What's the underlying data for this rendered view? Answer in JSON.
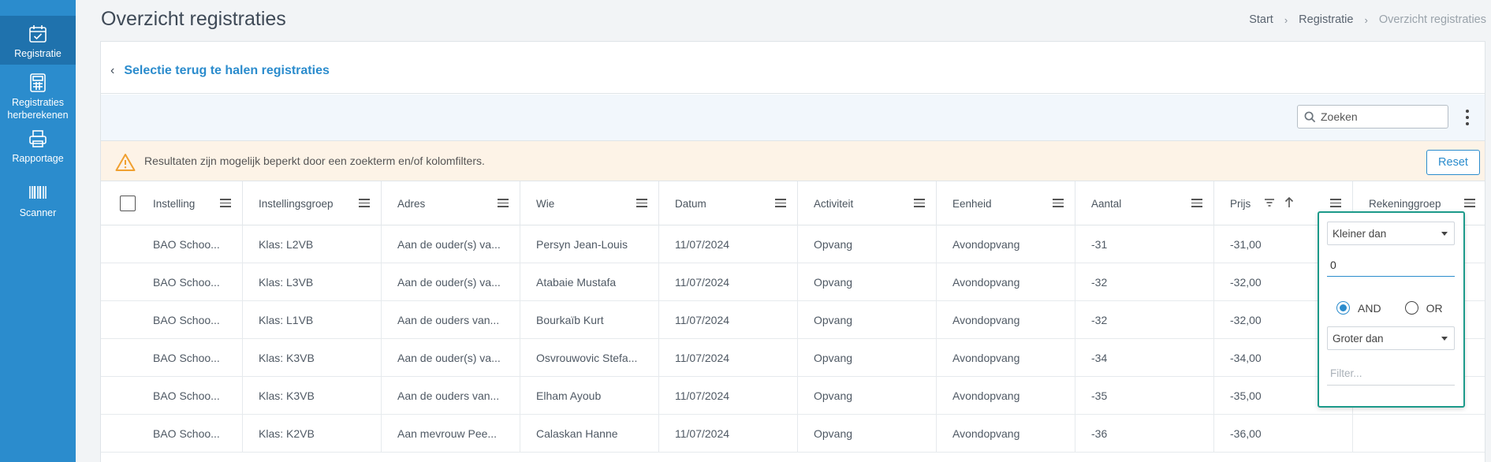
{
  "sidebar": {
    "items": [
      {
        "label": "Registratie",
        "icon": "calendar-check-icon"
      },
      {
        "label": "Registraties herberekenen",
        "icon": "calculator-icon"
      },
      {
        "label": "Rapportage",
        "icon": "printer-icon"
      },
      {
        "label": "Scanner",
        "icon": "barcode-icon"
      }
    ]
  },
  "header": {
    "title": "Overzicht registraties",
    "breadcrumb": [
      "Start",
      "Registratie",
      "Overzicht registraties"
    ]
  },
  "card": {
    "back_label": "Selectie terug te halen registraties",
    "search_placeholder": "Zoeken",
    "warning": "Resultaten zijn mogelijk beperkt door een zoekterm en/of kolomfilters.",
    "reset_label": "Reset"
  },
  "table": {
    "columns": [
      "Instelling",
      "Instellingsgroep",
      "Adres",
      "Wie",
      "Datum",
      "Activiteit",
      "Eenheid",
      "Aantal",
      "Prijs",
      "Rekeninggroep"
    ],
    "rows": [
      [
        "BAO Schoo...",
        "Klas: L2VB",
        "Aan de ouder(s) va...",
        "Persyn Jean-Louis",
        "11/07/2024",
        "Opvang",
        "Avondopvang",
        "-31",
        "-31,00",
        ""
      ],
      [
        "BAO Schoo...",
        "Klas: L3VB",
        "Aan de ouder(s) va...",
        "Atabaie Mustafa",
        "11/07/2024",
        "Opvang",
        "Avondopvang",
        "-32",
        "-32,00",
        ""
      ],
      [
        "BAO Schoo...",
        "Klas: L1VB",
        "Aan de ouders van...",
        "Bourkaïb Kurt",
        "11/07/2024",
        "Opvang",
        "Avondopvang",
        "-32",
        "-32,00",
        ""
      ],
      [
        "BAO Schoo...",
        "Klas: K3VB",
        "Aan de ouder(s) va...",
        "Osvrouwovic Stefa...",
        "11/07/2024",
        "Opvang",
        "Avondopvang",
        "-34",
        "-34,00",
        ""
      ],
      [
        "BAO Schoo...",
        "Klas: K3VB",
        "Aan de ouders van...",
        "Elham Ayoub",
        "11/07/2024",
        "Opvang",
        "Avondopvang",
        "-35",
        "-35,00",
        ""
      ],
      [
        "BAO Schoo...",
        "Klas: K2VB",
        "Aan mevrouw Pee...",
        "Calaskan Hanne",
        "11/07/2024",
        "Opvang",
        "Avondopvang",
        "-36",
        "-36,00",
        ""
      ]
    ]
  },
  "filter_popup": {
    "condition1": "Kleiner dan",
    "value1": "0",
    "operator_and": "AND",
    "operator_or": "OR",
    "selected_operator": "AND",
    "condition2": "Groter dan",
    "value2_placeholder": "Filter..."
  },
  "colors": {
    "sidebar": "#2b8ccd",
    "accent": "#2b8ccd",
    "warning_bg": "#fdf3e7",
    "warning_icon": "#f0a030",
    "popup_border": "#1c9a8a"
  }
}
